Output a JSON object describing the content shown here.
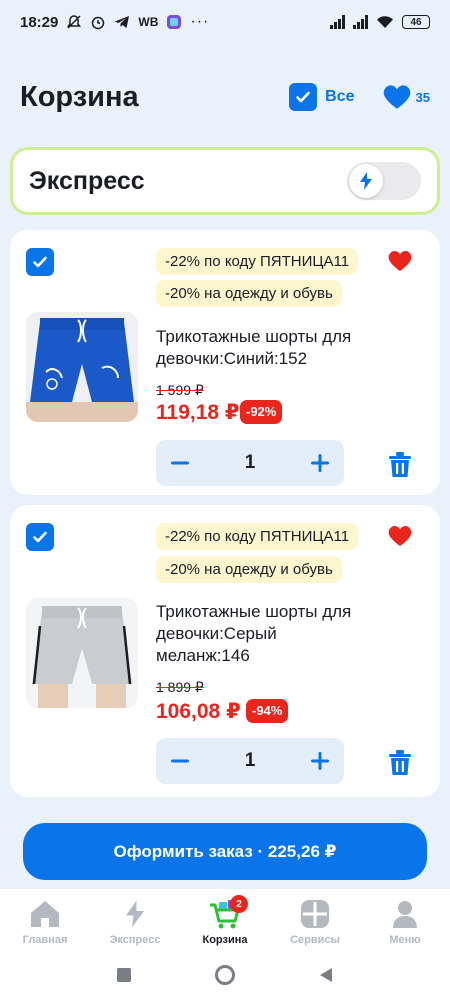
{
  "status": {
    "time": "18:29",
    "battery": "46",
    "wb_label": "WB"
  },
  "header": {
    "title": "Корзина",
    "select_all_label": "Все",
    "favorites_count": "35"
  },
  "express": {
    "label": "Экспресс",
    "enabled": false
  },
  "items": [
    {
      "promo1": "-22% по коду ПЯТНИЦА11",
      "promo2": "-20% на одежду и обувь",
      "name": "Трикотажные шорты для девочки:Синий:152",
      "old_price": "1 599 ₽",
      "price": "119,18 ₽",
      "discount": "-92%",
      "quantity": "1",
      "image": "blue-shorts"
    },
    {
      "promo1": "-22% по коду ПЯТНИЦА11",
      "promo2": "-20% на одежду и обувь",
      "name": "Трикотажные шорты для девочки:Серый меланж:146",
      "old_price": "1 899 ₽",
      "price": "106,08 ₽",
      "discount": "-94%",
      "quantity": "1",
      "image": "grey-shorts"
    }
  ],
  "checkout": {
    "label": "Оформить заказ · 225,26 ₽"
  },
  "nav": {
    "home": "Главная",
    "express": "Экспресс",
    "cart": "Корзина",
    "cart_badge": "2",
    "services": "Сервисы",
    "menu": "Меню"
  },
  "colors": {
    "accent": "#0a74ea",
    "sale": "#e8261e",
    "promo_bg": "#fdf6cf",
    "express_border": "#ccef8f"
  }
}
